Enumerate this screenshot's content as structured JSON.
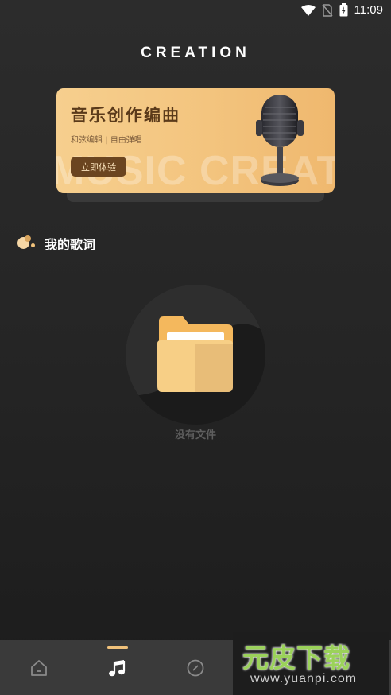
{
  "status_bar": {
    "time": "11:09",
    "icons": [
      "wifi-icon",
      "no-sim-icon",
      "battery-charging-icon"
    ]
  },
  "header": {
    "title": "CREATION"
  },
  "banner": {
    "title": "音乐创作编曲",
    "subtitle": "和弦编辑 | 自由弹唱",
    "button_label": "立即体验",
    "watermark_text": "MUSIC CREATION",
    "icon": "microphone-icon",
    "colors": {
      "gradient_start": "#f6cf8e",
      "gradient_end": "#efb86e",
      "button_bg": "#6b4520"
    }
  },
  "section": {
    "title": "我的歌词",
    "icon": "dots-icon"
  },
  "empty_state": {
    "text": "没有文件",
    "icon": "folder-icon"
  },
  "bottom_nav": {
    "active_index": 1,
    "accent_color": "#f1c27b",
    "items": [
      {
        "icon": "home-icon"
      },
      {
        "icon": "music-note-icon"
      },
      {
        "icon": "compass-icon"
      },
      {
        "icon": "profile-icon"
      },
      {
        "icon": "profile-icon"
      }
    ]
  },
  "watermark": {
    "logo_text": "元皮下载",
    "url": "www.yuanpi.com"
  }
}
